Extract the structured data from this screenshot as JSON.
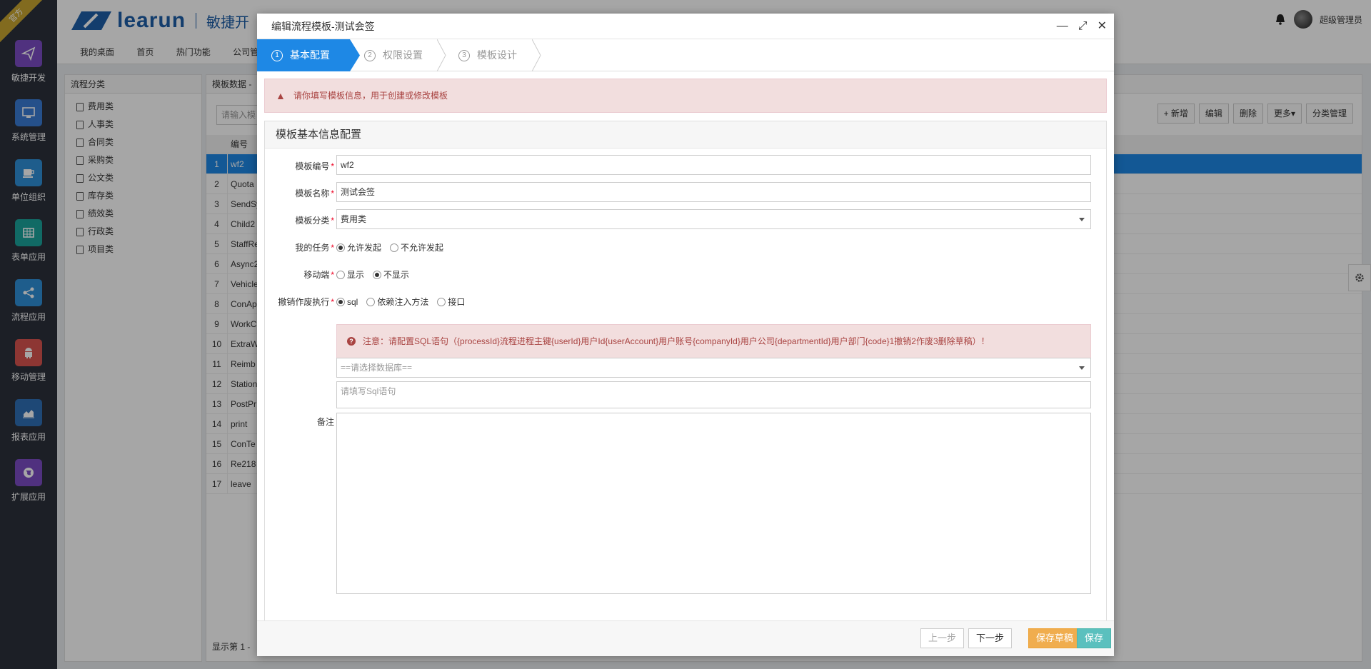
{
  "app": {
    "badge": "官方",
    "logo_word": "learun",
    "logo_cn": "敏捷开",
    "user": "超级管理员"
  },
  "leftnav": [
    {
      "label": "敏捷开发",
      "icon": "paper-plane-icon",
      "color": "#7b4cc4"
    },
    {
      "label": "系统管理",
      "icon": "monitor-icon",
      "color": "#3a7bd5"
    },
    {
      "label": "单位组织",
      "icon": "coffee-cup-icon",
      "color": "#2f8fd8"
    },
    {
      "label": "表单应用",
      "icon": "table-grid-icon",
      "color": "#1ba39c"
    },
    {
      "label": "流程应用",
      "icon": "share-nodes-icon",
      "color": "#2f8fd8"
    },
    {
      "label": "移动管理",
      "icon": "android-icon",
      "color": "#d9534f"
    },
    {
      "label": "报表应用",
      "icon": "area-chart-icon",
      "color": "#2f6fb5"
    },
    {
      "label": "扩展应用",
      "icon": "globe-icon",
      "color": "#7b4cc4"
    }
  ],
  "tabs": [
    "我的桌面",
    "首页",
    "热门功能",
    "公司管"
  ],
  "left_panel": {
    "title": "流程分类",
    "items": [
      "费用类",
      "人事类",
      "合同类",
      "采购类",
      "公文类",
      "库存类",
      "绩效类",
      "行政类",
      "项目类"
    ]
  },
  "main_panel": {
    "title": "模板数据 - ",
    "search_placeholder": "请输入模",
    "col_code": "编号",
    "rows": [
      "wf2",
      "Quota",
      "SendSy",
      "Child2",
      "StaffRe",
      "Async2",
      "Vehicle",
      "ConAp",
      "WorkC",
      "ExtraW",
      "Reimb",
      "Station",
      "PostPr",
      "print",
      "ConTe",
      "Re218",
      "leave"
    ],
    "footer_text": "显示第 1 -",
    "toolbar": [
      "+ 新增",
      "编辑",
      "删除",
      "更多▾",
      "分类管理"
    ]
  },
  "modal": {
    "title": "编辑流程模板-测试会签",
    "steps": [
      {
        "num": "1",
        "label": "基本配置"
      },
      {
        "num": "2",
        "label": "权限设置"
      },
      {
        "num": "3",
        "label": "模板设计"
      }
    ],
    "alert": "请你填写模板信息，用于创建或修改模板",
    "section_title": "模板基本信息配置",
    "fields": {
      "code_label": "模板编号",
      "code_value": "wf2",
      "name_label": "模板名称",
      "name_value": "测试会签",
      "category_label": "模板分类",
      "category_value": "费用类",
      "task_label": "我的任务",
      "task_opt1": "允许发起",
      "task_opt2": "不允许发起",
      "mobile_label": "移动端",
      "mobile_opt1": "显示",
      "mobile_opt2": "不显示",
      "undo_label": "撤销作废执行",
      "undo_opt1": "sql",
      "undo_opt2": "依赖注入方法",
      "undo_opt3": "接口",
      "note_text": "注意：请配置SQL语句（{processId}流程进程主键{userId}用户Id{userAccount}用户账号{companyId}用户公司{departmentId}用户部门{code}1撤销2作废3删除草稿）！",
      "db_placeholder": "==请选择数据库==",
      "sql_placeholder": "请填写Sql语句",
      "remark_label": "备注"
    },
    "buttons": {
      "prev": "上一步",
      "next": "下一步",
      "draft": "保存草稿",
      "save": "保存"
    }
  }
}
